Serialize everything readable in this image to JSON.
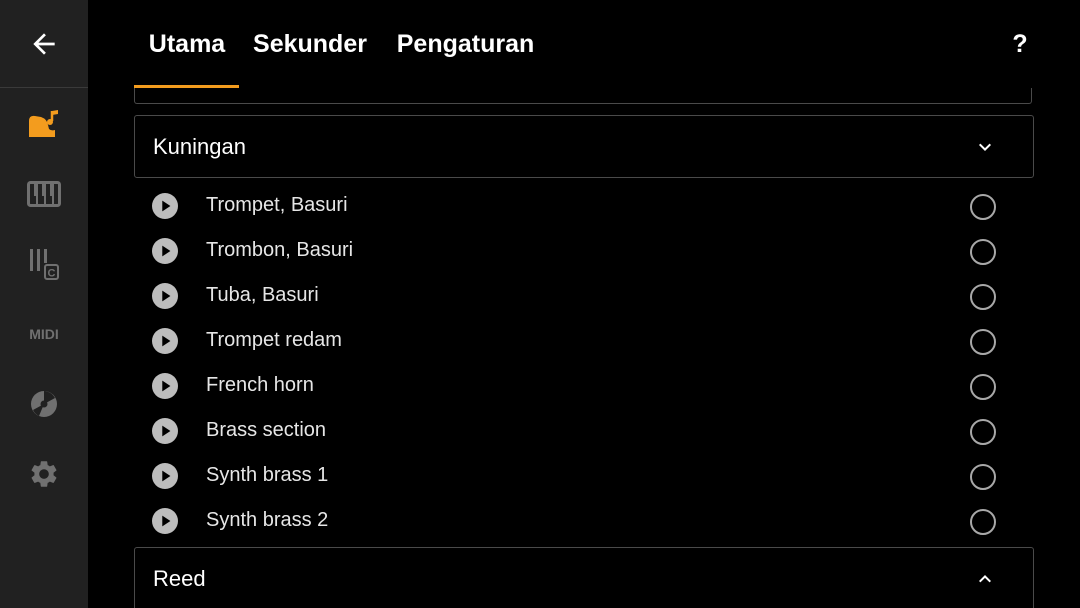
{
  "sidebar": {
    "back_icon": "arrow-left-icon",
    "items": [
      {
        "icon": "instrument-note-icon",
        "active": true
      },
      {
        "icon": "piano-keys-icon",
        "active": false
      },
      {
        "icon": "chord-keys-icon",
        "active": false
      },
      {
        "icon": "midi-icon",
        "active": false,
        "label": "MIDI"
      },
      {
        "icon": "disc-icon",
        "active": false
      },
      {
        "icon": "gear-icon",
        "active": false
      }
    ],
    "active_color": "#f39c1e",
    "inactive_color": "#707070"
  },
  "header": {
    "tabs": [
      {
        "label": "Utama",
        "active": true
      },
      {
        "label": "Sekunder",
        "active": false
      },
      {
        "label": "Pengaturan",
        "active": false
      }
    ],
    "help_label": "?",
    "indicator_color": "#f39c1e"
  },
  "groups": [
    {
      "title": "Kuningan",
      "expanded": true,
      "items": [
        {
          "label": "Trompet, Basuri",
          "selected": false
        },
        {
          "label": "Trombon, Basuri",
          "selected": false
        },
        {
          "label": "Tuba, Basuri",
          "selected": false
        },
        {
          "label": "Trompet redam",
          "selected": false
        },
        {
          "label": "French horn",
          "selected": false
        },
        {
          "label": "Brass section",
          "selected": false
        },
        {
          "label": "Synth brass 1",
          "selected": false
        },
        {
          "label": "Synth brass 2",
          "selected": false
        }
      ]
    },
    {
      "title": "Reed",
      "expanded": false
    }
  ]
}
